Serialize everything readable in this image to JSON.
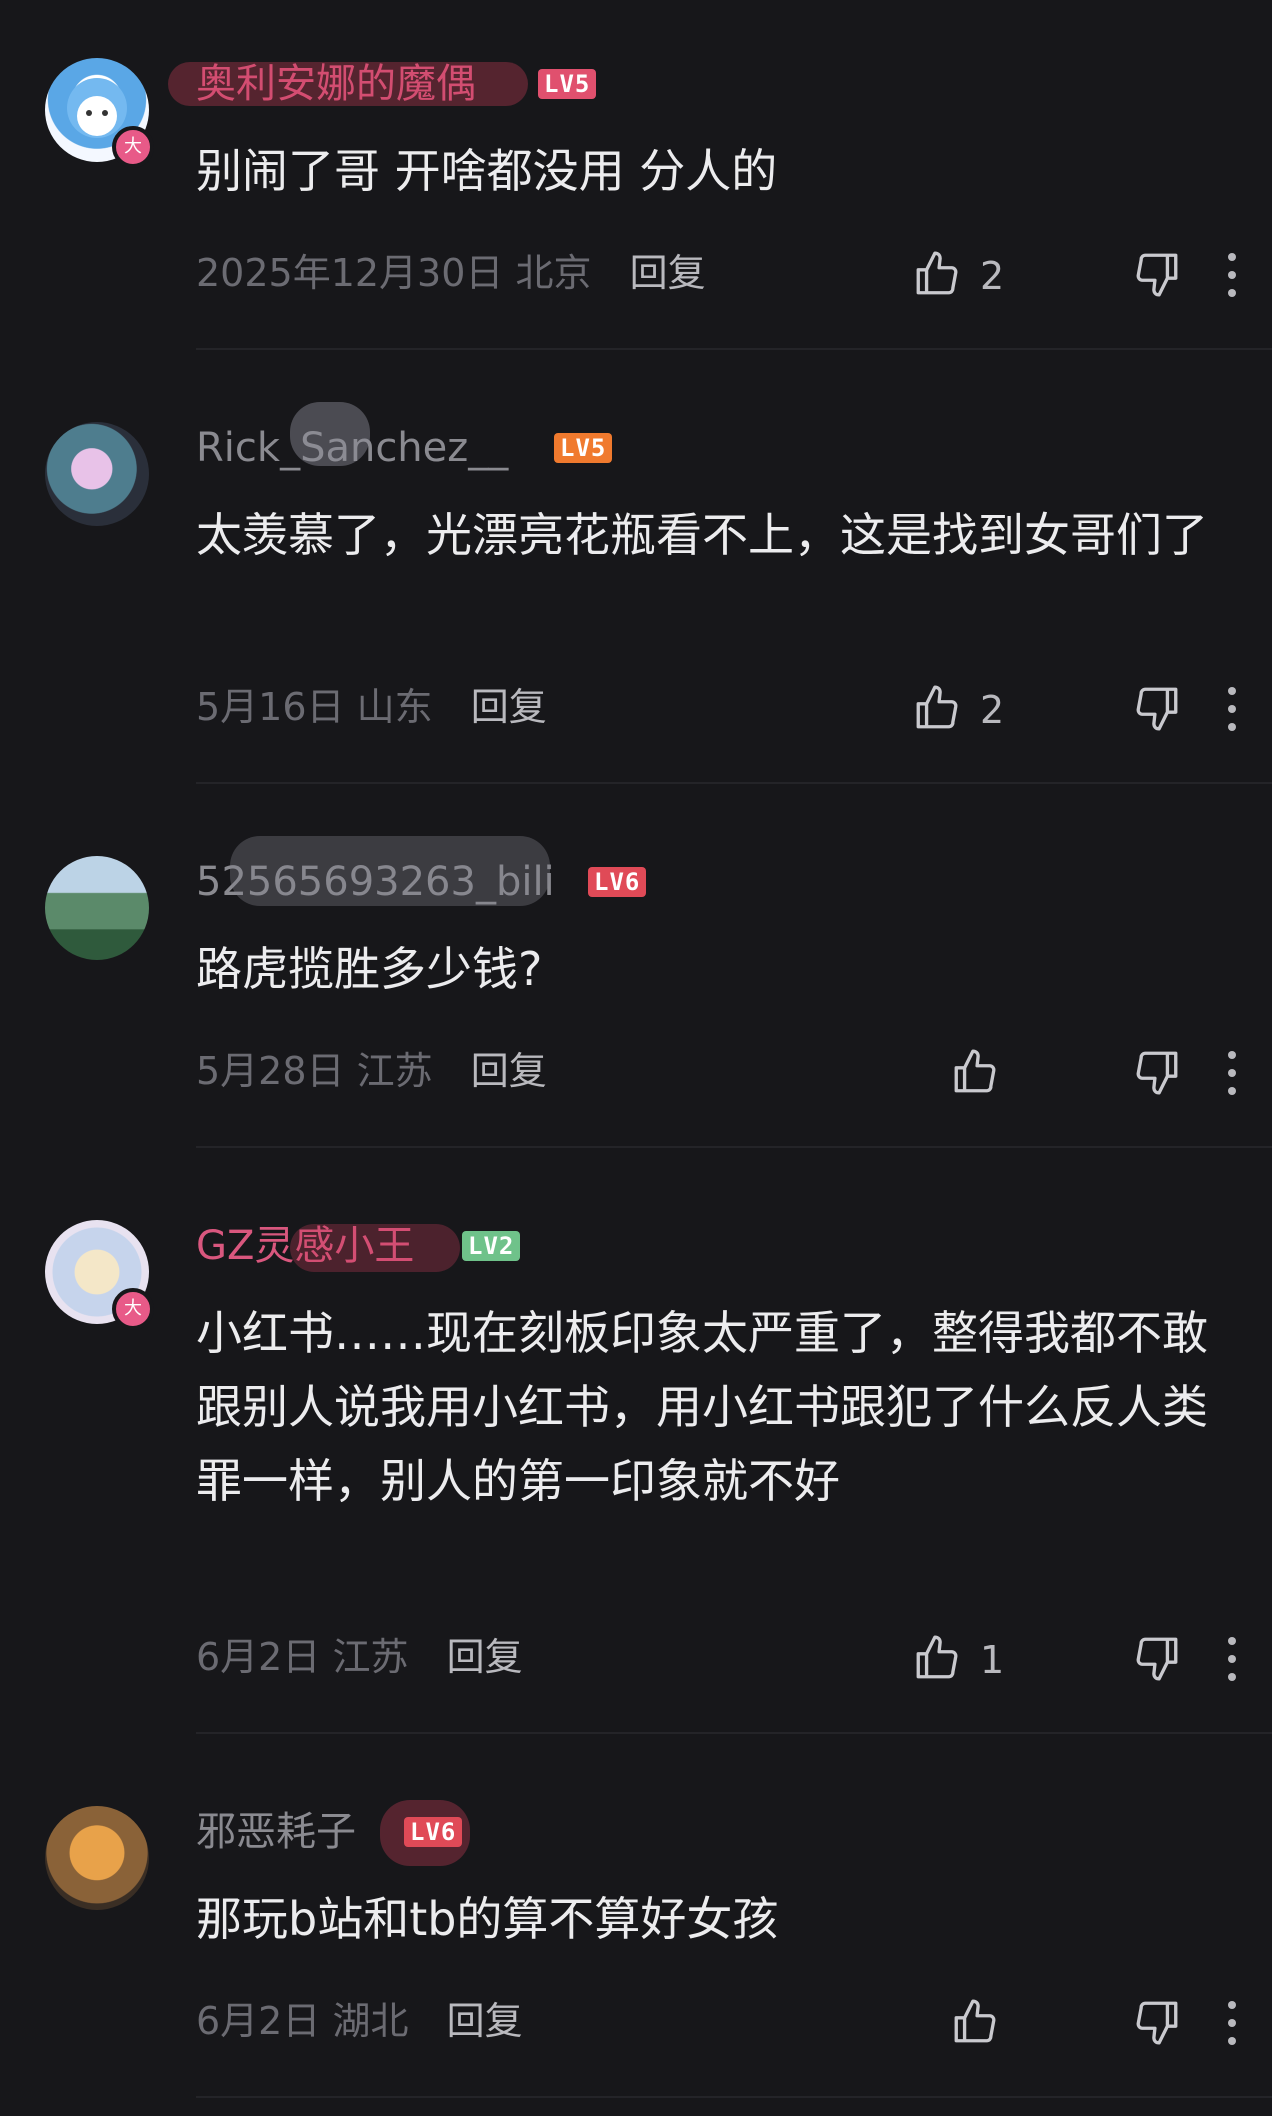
{
  "comments": [
    {
      "username": "奥利安娜的魔偶",
      "level": "LV5",
      "content": "别闹了哥 开啥都没用 分人的",
      "date": "2025年12月30日",
      "location": "北京",
      "reply_label": "回复",
      "likes": "2",
      "badge": "大",
      "colors": {
        "username": "#d9577e",
        "level": "#e0506e"
      }
    },
    {
      "username": "Rick_Sanchez__",
      "level": "LV5",
      "content": "太羡慕了，光漂亮花瓶看不上，这是找到女哥们了",
      "date": "5月16日",
      "location": "山东",
      "reply_label": "回复",
      "likes": "2",
      "colors": {
        "username": "#8a8a90",
        "level": "#f07a2e"
      }
    },
    {
      "username": "52565693263_bili",
      "level": "LV6",
      "content": "路虎揽胜多少钱?",
      "date": "5月28日",
      "location": "江苏",
      "reply_label": "回复",
      "likes": "",
      "colors": {
        "username": "#8a8a90",
        "level": "#e04a57"
      }
    },
    {
      "username": "GZ灵感小王",
      "level": "LV2",
      "content": "小红书……现在刻板印象太严重了，整得我都不敢跟别人说我用小红书，用小红书跟犯了什么反人类罪一样，别人的第一印象就不好",
      "date": "6月2日",
      "location": "江苏",
      "reply_label": "回复",
      "likes": "1",
      "badge": "大",
      "colors": {
        "username": "#d9577e",
        "level": "#6fc28a"
      }
    },
    {
      "username": "邪恶耗子",
      "level": "LV6",
      "content": "那玩b站和tb的算不算好女孩",
      "date": "6月2日",
      "location": "湖北",
      "reply_label": "回复",
      "likes": "",
      "colors": {
        "username": "#8a8a90",
        "level": "#e04a57"
      }
    }
  ],
  "icons": {
    "like": "thumbs-up-icon",
    "dislike": "thumbs-down-icon",
    "more": "more-vertical-icon"
  }
}
